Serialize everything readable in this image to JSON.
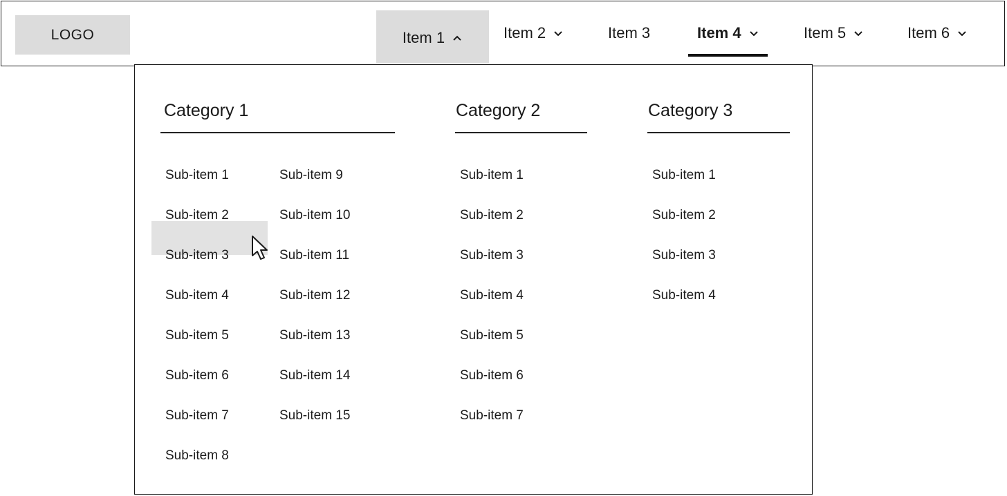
{
  "logo": {
    "label": "LOGO"
  },
  "nav": {
    "items": [
      {
        "label": "Item 1",
        "chevron": "chevron-up-icon"
      },
      {
        "label": "Item 2",
        "chevron": "chevron-down-icon"
      },
      {
        "label": "Item 3"
      },
      {
        "label": "Item 4",
        "chevron": "chevron-down-icon"
      },
      {
        "label": "Item 5",
        "chevron": "chevron-down-icon"
      },
      {
        "label": "Item 6",
        "chevron": "chevron-down-icon"
      }
    ],
    "open_item": "Item 1",
    "active_item": "Item 4"
  },
  "dropdown": {
    "categories": [
      {
        "title": "Category 1",
        "columns": [
          [
            "Sub-item 1",
            "Sub-item 2",
            "Sub-item 3",
            "Sub-item 4",
            "Sub-item 5",
            "Sub-item 6",
            "Sub-item 7",
            "Sub-item 8"
          ],
          [
            "Sub-item 9",
            "Sub-item 10",
            "Sub-item 11",
            "Sub-item 12",
            "Sub-item 13",
            "Sub-item 14",
            "Sub-item 15"
          ]
        ]
      },
      {
        "title": "Category 2",
        "columns": [
          [
            "Sub-item 1",
            "Sub-item 2",
            "Sub-item 3",
            "Sub-item 4",
            "Sub-item 5",
            "Sub-item 6",
            "Sub-item 7"
          ]
        ]
      },
      {
        "title": "Category 3",
        "columns": [
          [
            "Sub-item 1",
            "Sub-item 2",
            "Sub-item 3",
            "Sub-item 4"
          ]
        ]
      }
    ],
    "hovered_item": "Sub-item 3"
  },
  "colors": {
    "border": "#1a1a1a",
    "highlight": "#dcdcdc",
    "text": "#111111"
  }
}
